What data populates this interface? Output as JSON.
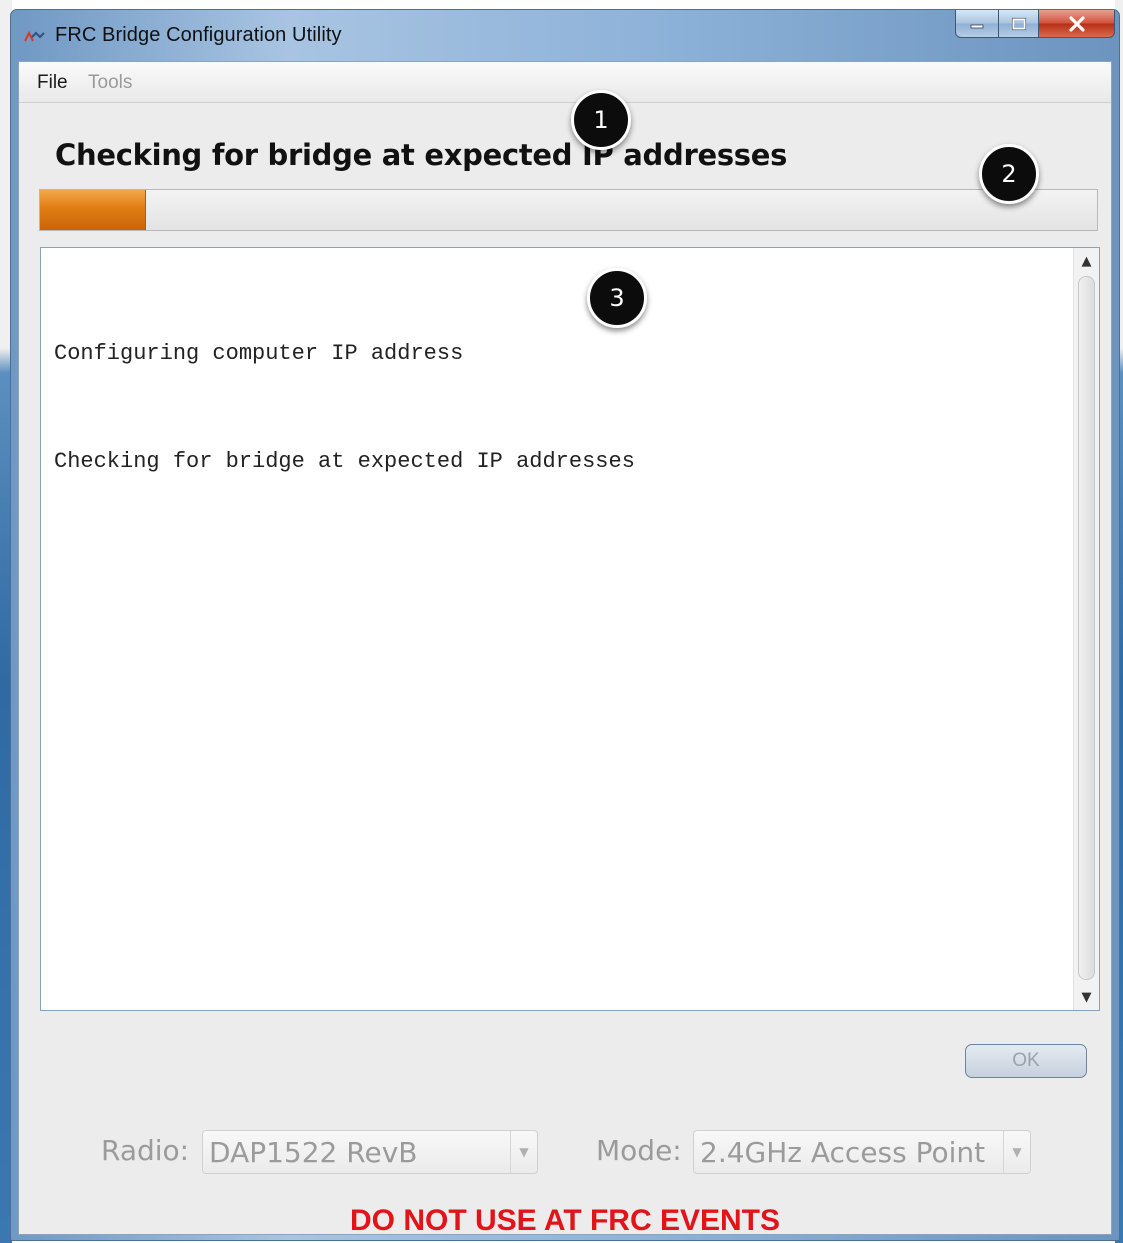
{
  "window": {
    "title": "FRC Bridge Configuration Utility",
    "icon": "frc-logo-icon"
  },
  "menu": {
    "items": [
      {
        "label": "File",
        "enabled": true
      },
      {
        "label": "Tools",
        "enabled": false
      }
    ]
  },
  "status": {
    "heading": "Checking for bridge at expected IP addresses",
    "progress_fraction": 0.1
  },
  "log": {
    "lines": [
      "Configuring computer IP address",
      "Checking for bridge at expected IP addresses"
    ]
  },
  "buttons": {
    "ok_label": "OK"
  },
  "settings": {
    "radio_label": "Radio:",
    "radio_value": "DAP1522 RevB",
    "mode_label": "Mode:",
    "mode_value": "2.4GHz Access Point"
  },
  "warning": {
    "text": "DO NOT USE AT FRC EVENTS",
    "color": "#e2141a"
  },
  "annotations": [
    "1",
    "2",
    "3"
  ],
  "colors": {
    "progress_fill": "#e07d12",
    "title_bar": "#8cb1d8"
  }
}
